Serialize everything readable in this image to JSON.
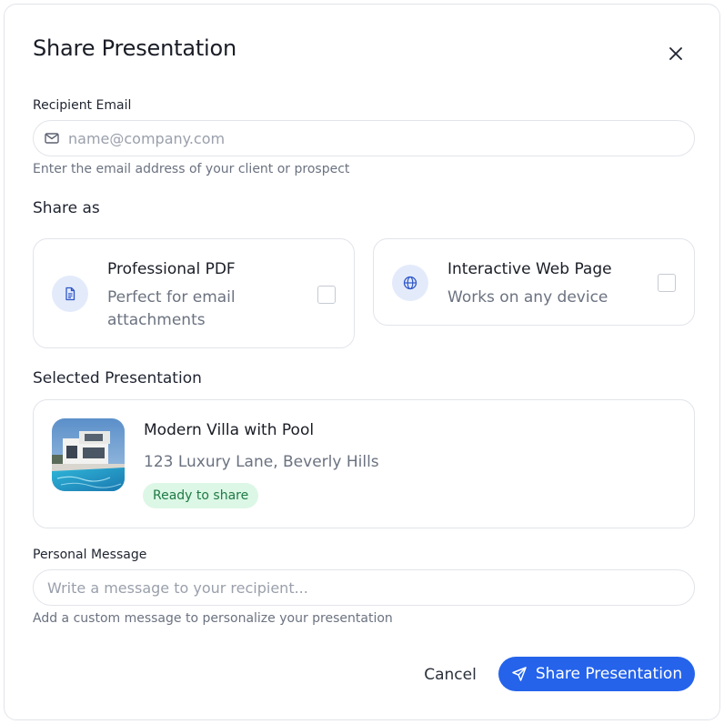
{
  "dialog": {
    "title": "Share Presentation",
    "close_icon": "close-icon"
  },
  "recipient": {
    "label": "Recipient Email",
    "placeholder": "name@company.com",
    "value": "",
    "icon": "mail-icon",
    "helper": "Enter the email address of your client or prospect"
  },
  "share_as": {
    "label": "Share as",
    "options": [
      {
        "title": "Professional PDF",
        "description": "Perfect for email attachments",
        "icon": "document-icon",
        "checked": false
      },
      {
        "title": "Interactive Web Page",
        "description": "Works on any device",
        "icon": "globe-icon",
        "checked": false
      }
    ]
  },
  "selected": {
    "label": "Selected Presentation",
    "title": "Modern Villa with Pool",
    "address": "123 Luxury Lane, Beverly Hills",
    "status": "Ready to share"
  },
  "message": {
    "label": "Personal Message",
    "placeholder": "Write a message to your recipient...",
    "value": "",
    "helper": "Add a custom message to personalize your presentation"
  },
  "actions": {
    "cancel": "Cancel",
    "share": "Share Presentation",
    "share_icon": "send-icon"
  },
  "colors": {
    "accent": "#2563eb",
    "icon_bg": "#e3ebfb",
    "badge_bg": "#dcf7e6",
    "badge_text": "#1f7a44",
    "border": "#e2e4ea"
  }
}
